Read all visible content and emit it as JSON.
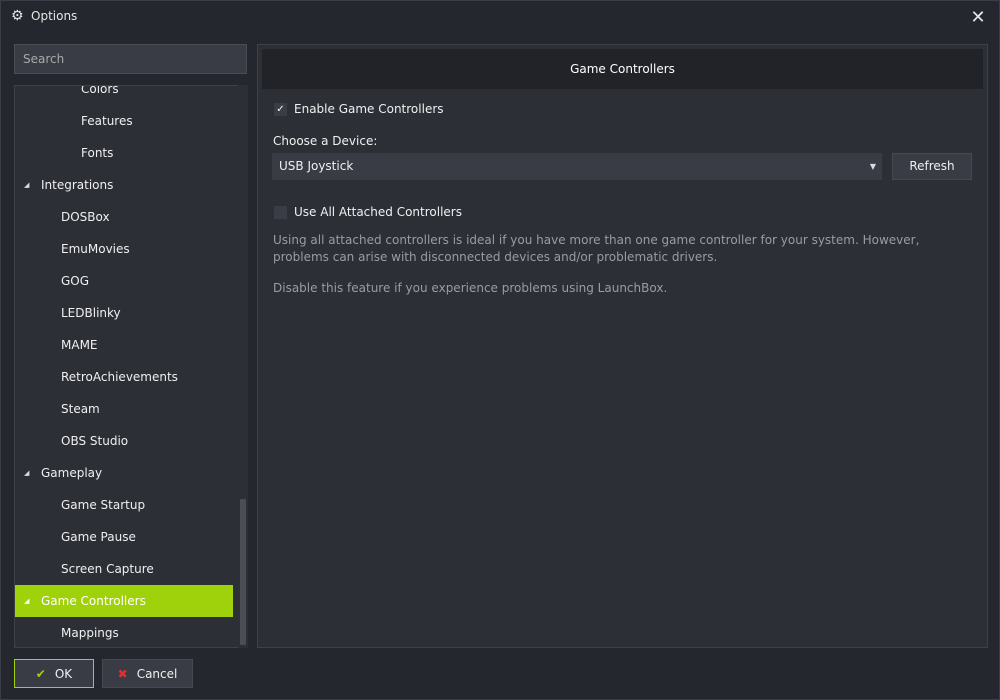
{
  "window": {
    "title": "Options",
    "title_icon": "gear-icon",
    "close_icon": "close-icon"
  },
  "sidebar": {
    "search_placeholder": "Search",
    "items": [
      {
        "label": "Colors",
        "level": 2,
        "expanded": null,
        "selected": false
      },
      {
        "label": "Features",
        "level": 2,
        "expanded": null,
        "selected": false
      },
      {
        "label": "Fonts",
        "level": 2,
        "expanded": null,
        "selected": false
      },
      {
        "label": "Integrations",
        "level": 1,
        "expanded": true,
        "selected": false
      },
      {
        "label": "DOSBox",
        "level": 2,
        "expanded": null,
        "selected": false
      },
      {
        "label": "EmuMovies",
        "level": 2,
        "expanded": null,
        "selected": false
      },
      {
        "label": "GOG",
        "level": 2,
        "expanded": null,
        "selected": false
      },
      {
        "label": "LEDBlinky",
        "level": 2,
        "expanded": null,
        "selected": false
      },
      {
        "label": "MAME",
        "level": 2,
        "expanded": null,
        "selected": false
      },
      {
        "label": "RetroAchievements",
        "level": 2,
        "expanded": null,
        "selected": false
      },
      {
        "label": "Steam",
        "level": 2,
        "expanded": null,
        "selected": false
      },
      {
        "label": "OBS Studio",
        "level": 2,
        "expanded": null,
        "selected": false
      },
      {
        "label": "Gameplay",
        "level": 1,
        "expanded": true,
        "selected": false
      },
      {
        "label": "Game Startup",
        "level": 2,
        "expanded": null,
        "selected": false
      },
      {
        "label": "Game Pause",
        "level": 2,
        "expanded": null,
        "selected": false
      },
      {
        "label": "Screen Capture",
        "level": 2,
        "expanded": null,
        "selected": false
      },
      {
        "label": "Game Controllers",
        "level": 1,
        "expanded": true,
        "selected": true
      },
      {
        "label": "Mappings",
        "level": 2,
        "expanded": null,
        "selected": false
      }
    ],
    "selected_color": "#9fd20b"
  },
  "main": {
    "header": "Game Controllers",
    "enable_checkbox": {
      "label": "Enable Game Controllers",
      "checked": true
    },
    "device_label": "Choose a Device:",
    "device_value": "USB Joystick",
    "refresh_label": "Refresh",
    "use_all_checkbox": {
      "label": "Use All Attached Controllers",
      "checked": false
    },
    "description_1": "Using all attached controllers is ideal if you have more than one game controller for your system. However, problems can arise with disconnected devices and/or problematic drivers.",
    "description_2": "Disable this feature if you experience problems using LaunchBox."
  },
  "footer": {
    "ok_label": "OK",
    "ok_icon": "checkmark-icon",
    "cancel_label": "Cancel",
    "cancel_icon": "x-icon",
    "accent_color": "#9fd20b",
    "cancel_icon_color": "#e03030"
  }
}
